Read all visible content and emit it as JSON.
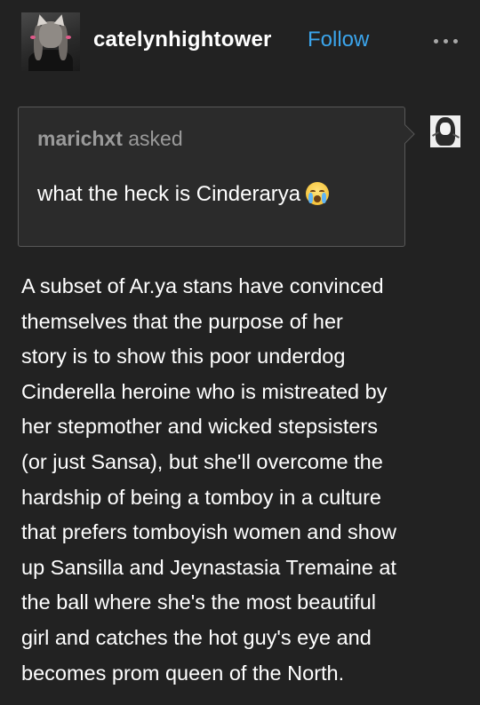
{
  "header": {
    "username": "catelynhightower",
    "follow_label": "Follow",
    "avatar_icon": "profile-avatar",
    "more_icon": "more-dots-icon",
    "follow_color": "#3ba5ec"
  },
  "ask": {
    "asker_name": "marichxt",
    "asked_label": "asked",
    "question": "what the heck is Cinderarya",
    "emoji_icon": "loudly-crying-face-icon"
  },
  "answer": {
    "lines": [
      "A subset of Ar.ya stans have convinced",
      "themselves that the purpose of her",
      "story is to show this poor underdog",
      "Cinderella heroine who is mistreated by",
      "her stepmother and wicked stepsisters",
      "(or just Sansa), but she'll overcome the",
      "hardship of being a tomboy in a culture",
      "that prefers tomboyish women and show",
      "up Sansilla and Jeynastasia Tremaine at",
      "the ball where she's the most beautiful",
      "girl and catches the hot guy's eye and",
      "becomes prom queen of the North."
    ]
  },
  "colors": {
    "background": "#222222",
    "ask_box": "#2b2b2b",
    "ask_border": "#585858",
    "muted_text": "#9a9a9a"
  }
}
